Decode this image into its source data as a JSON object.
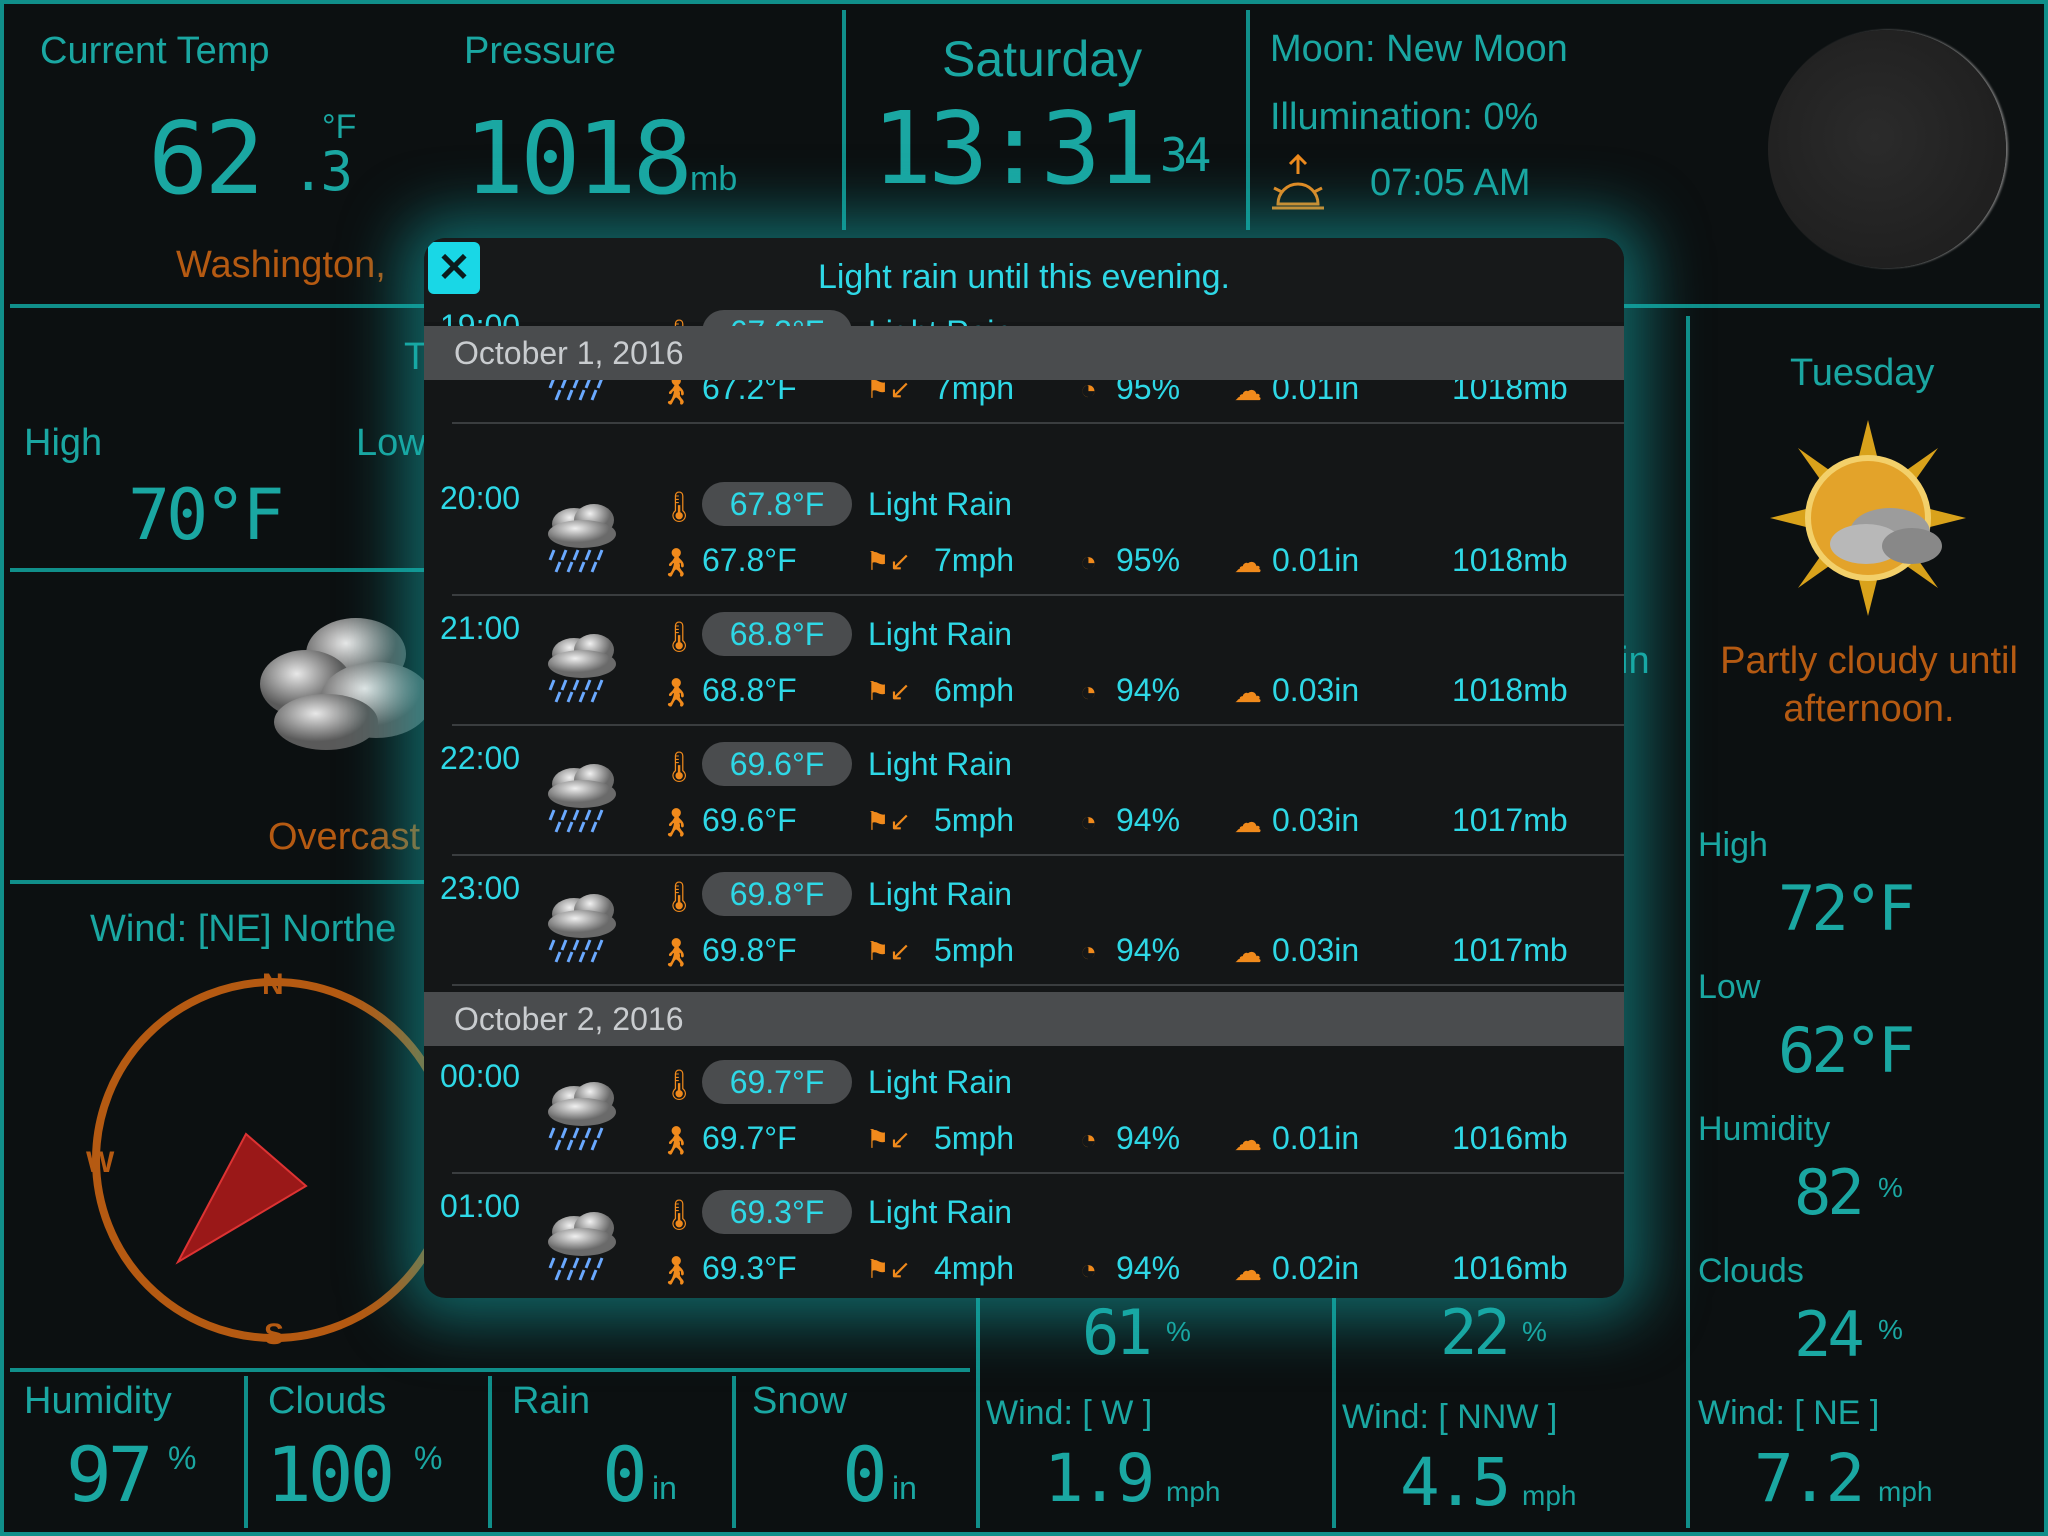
{
  "current": {
    "temp_label": "Current Temp",
    "temp_value": "62",
    "temp_decimal": ".3",
    "temp_unit": "°F",
    "pressure_label": "Pressure",
    "pressure_value": "1018",
    "pressure_unit": "mb",
    "location": "Washington, ",
    "high_label": "High",
    "high_value": "70°F",
    "low_label": "Low",
    "today_partial": "T",
    "condition": "Overcast",
    "wind_label": "Wind: [NE] Northe"
  },
  "clock": {
    "day": "Saturday",
    "time": "13:31",
    "seconds": "34"
  },
  "moon": {
    "phase": "Moon: New Moon",
    "illumination": "Illumination: 0%",
    "sunrise": "07:05 AM"
  },
  "compass": {
    "n": "N",
    "w": "W",
    "s": "S"
  },
  "bottom": {
    "humidity_label": "Humidity",
    "humidity_value": "97",
    "humidity_unit": "%",
    "clouds_label": "Clouds",
    "clouds_value": "100",
    "clouds_unit": "%",
    "rain_label": "Rain",
    "rain_value": "0",
    "rain_unit": "in",
    "snow_label": "Snow",
    "snow_value": "0",
    "snow_unit": "in"
  },
  "forecast_cols": {
    "c1_value": "61",
    "c1_unit": "%",
    "c1_wind": "Wind: [ W ]",
    "c1_speed": "1.9",
    "c1_speed_unit": "mph",
    "c2_value": "22",
    "c2_unit": "%",
    "c2_wind": "Wind: [ NNW ]",
    "c2_speed": "4.5",
    "c2_speed_unit": "mph",
    "mid_partial": "in"
  },
  "tuesday": {
    "day": "Tuesday",
    "condition_line1": "Partly cloudy until",
    "condition_line2": "afternoon.",
    "high_label": "High",
    "high_value": "72°F",
    "low_label": "Low",
    "low_value": "62°F",
    "humidity_label": "Humidity",
    "humidity_value": "82",
    "humidity_unit": "%",
    "clouds_label": "Clouds",
    "clouds_value": "24",
    "clouds_unit": "%",
    "wind_label": "Wind: [ NE ]",
    "wind_speed": "7.2",
    "wind_unit": "mph"
  },
  "modal": {
    "close_glyph": "✕",
    "title": "Light rain until this evening.",
    "date1": "October 1, 2016",
    "date2": "October 2, 2016",
    "rows": [
      {
        "time": "19:00",
        "temp": "67.2°F",
        "cond": "Light Rain",
        "feel": "67.2°F",
        "wind": "7mph",
        "hum": "95%",
        "rain": "0.01in",
        "pres": "1018mb"
      },
      {
        "time": "20:00",
        "temp": "67.8°F",
        "cond": "Light Rain",
        "feel": "67.8°F",
        "wind": "7mph",
        "hum": "95%",
        "rain": "0.01in",
        "pres": "1018mb"
      },
      {
        "time": "21:00",
        "temp": "68.8°F",
        "cond": "Light Rain",
        "feel": "68.8°F",
        "wind": "6mph",
        "hum": "94%",
        "rain": "0.03in",
        "pres": "1018mb"
      },
      {
        "time": "22:00",
        "temp": "69.6°F",
        "cond": "Light Rain",
        "feel": "69.6°F",
        "wind": "5mph",
        "hum": "94%",
        "rain": "0.03in",
        "pres": "1017mb"
      },
      {
        "time": "23:00",
        "temp": "69.8°F",
        "cond": "Light Rain",
        "feel": "69.8°F",
        "wind": "5mph",
        "hum": "94%",
        "rain": "0.03in",
        "pres": "1017mb"
      },
      {
        "time": "00:00",
        "temp": "69.7°F",
        "cond": "Light Rain",
        "feel": "69.7°F",
        "wind": "5mph",
        "hum": "94%",
        "rain": "0.01in",
        "pres": "1016mb"
      },
      {
        "time": "01:00",
        "temp": "69.3°F",
        "cond": "Light Rain",
        "feel": "69.3°F",
        "wind": "4mph",
        "hum": "94%",
        "rain": "0.02in",
        "pres": "1016mb"
      }
    ]
  },
  "colors": {
    "teal": "#1aa7a2",
    "orange": "#b55a12",
    "accent": "#2ed8e6",
    "icon_orange": "#f08a1c"
  }
}
